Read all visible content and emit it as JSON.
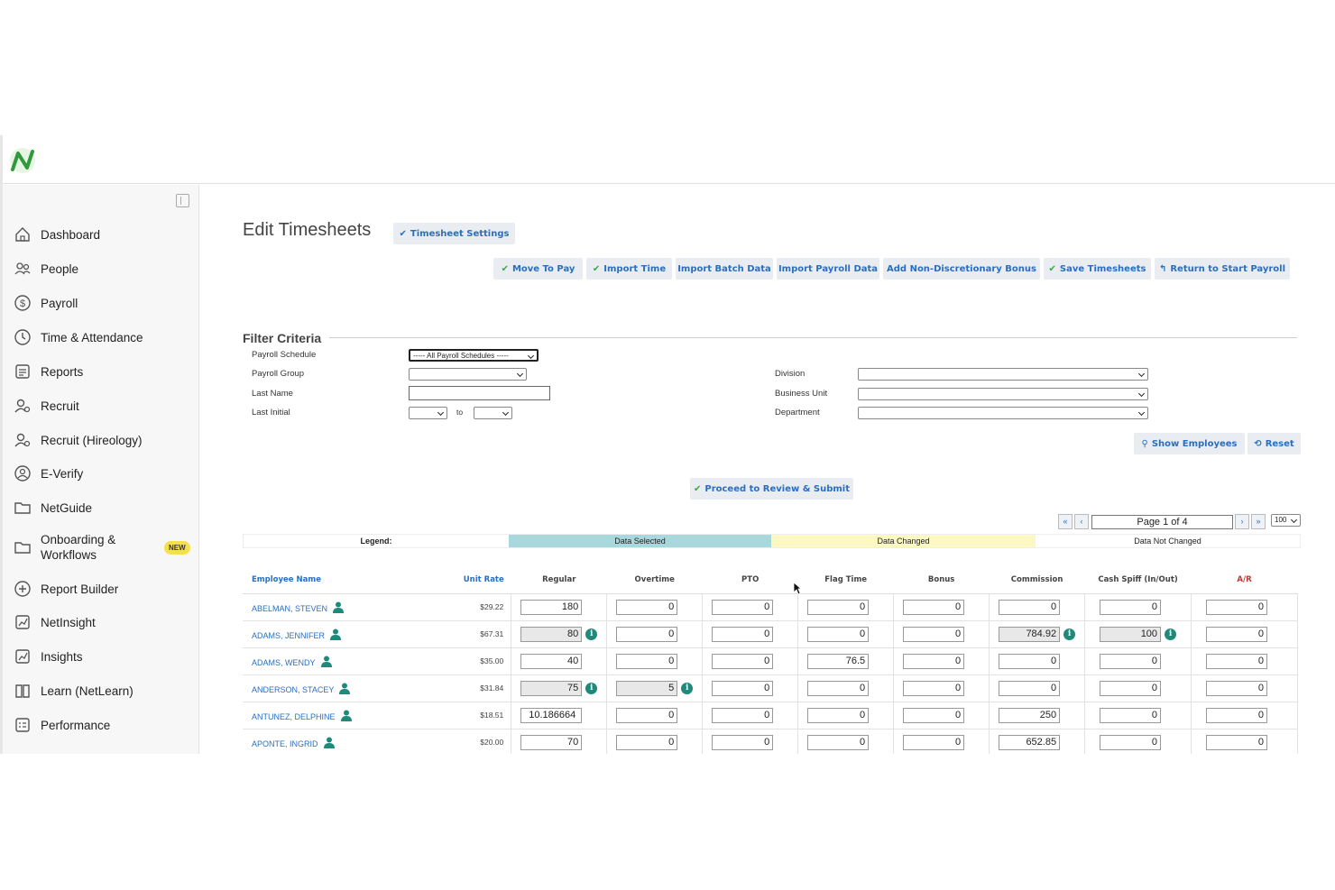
{
  "nav": {
    "items": [
      {
        "label": "Dashboard",
        "icon": "home-icon"
      },
      {
        "label": "People",
        "icon": "people-icon"
      },
      {
        "label": "Payroll",
        "icon": "dollar-icon"
      },
      {
        "label": "Time & Attendance",
        "icon": "clock-icon"
      },
      {
        "label": "Reports",
        "icon": "reports-icon"
      },
      {
        "label": "Recruit",
        "icon": "recruit-icon"
      },
      {
        "label": "Recruit (Hireology)",
        "icon": "recruit-icon"
      },
      {
        "label": "E-Verify",
        "icon": "verify-icon"
      },
      {
        "label": "NetGuide",
        "icon": "folder-icon"
      },
      {
        "label": "Onboarding & Workflows",
        "icon": "folder-icon",
        "badge": "NEW"
      },
      {
        "label": "Report Builder",
        "icon": "builder-icon"
      },
      {
        "label": "NetInsight",
        "icon": "chart-icon"
      },
      {
        "label": "Insights",
        "icon": "chart-icon"
      },
      {
        "label": "Learn (NetLearn)",
        "icon": "book-icon"
      },
      {
        "label": "Performance",
        "icon": "list-icon"
      }
    ]
  },
  "page": {
    "title": "Edit Timesheets",
    "timesheet_settings": "Timesheet Settings"
  },
  "toolbar": {
    "move_to_pay": "Move To Pay",
    "import_time": "Import Time",
    "import_batch": "Import Batch Data",
    "import_payroll": "Import Payroll Data",
    "add_bonus": "Add Non-Discretionary Bonus",
    "save_timesheets": "Save Timesheets",
    "return_start": "Return to Start Payroll",
    "show_employees": "Show Employees",
    "reset": "Reset",
    "proceed": "Proceed to Review & Submit"
  },
  "filter": {
    "title": "Filter Criteria",
    "payroll_schedule_label": "Payroll Schedule",
    "payroll_schedule_value": "----- All Payroll Schedules -----",
    "payroll_group_label": "Payroll Group",
    "last_name_label": "Last Name",
    "last_initial_label": "Last Initial",
    "to_label": "to",
    "division_label": "Division",
    "business_unit_label": "Business Unit",
    "department_label": "Department"
  },
  "legend": {
    "label": "Legend:",
    "selected": "Data Selected",
    "changed": "Data Changed",
    "not_changed": "Data Not Changed",
    "colors": {
      "selected": "#a8d8dc",
      "changed": "#fbf8c4"
    }
  },
  "pager": {
    "info": "Page 1 of 4",
    "per_page": "100"
  },
  "table": {
    "headers": [
      "Employee Name",
      "Unit Rate",
      "Regular",
      "Overtime",
      "PTO",
      "Flag Time",
      "Bonus",
      "Commission",
      "Cash Spiff (In/Out)",
      "A/R"
    ],
    "rows": [
      {
        "name": "ABELMAN, STEVEN",
        "rate": "$29.22",
        "vals": [
          "180",
          "0",
          "0",
          "0",
          "0",
          "0",
          "0",
          "0"
        ],
        "changed": []
      },
      {
        "name": "ADAMS, JENNIFER",
        "rate": "$67.31",
        "vals": [
          "80",
          "0",
          "0",
          "0",
          "0",
          "784.92",
          "100",
          "0"
        ],
        "changed": [
          0,
          5,
          6
        ]
      },
      {
        "name": "ADAMS, WENDY",
        "rate": "$35.00",
        "vals": [
          "40",
          "0",
          "0",
          "76.5",
          "0",
          "0",
          "0",
          "0"
        ],
        "changed": []
      },
      {
        "name": "ANDERSON, STACEY",
        "rate": "$31.84",
        "vals": [
          "75",
          "5",
          "0",
          "0",
          "0",
          "0",
          "0",
          "0"
        ],
        "changed": [
          0,
          1
        ]
      },
      {
        "name": "ANTUNEZ, DELPHINE",
        "rate": "$18.51",
        "vals": [
          "10.186664",
          "0",
          "0",
          "0",
          "0",
          "250",
          "0",
          "0"
        ],
        "changed": []
      },
      {
        "name": "APONTE, INGRID",
        "rate": "$20.00",
        "vals": [
          "70",
          "0",
          "0",
          "0",
          "0",
          "652.85",
          "0",
          "0"
        ],
        "changed": []
      }
    ]
  },
  "colors": {
    "accent": "#2a6fbf",
    "info": "#1d8a7a",
    "brand": "#3aa74a"
  }
}
